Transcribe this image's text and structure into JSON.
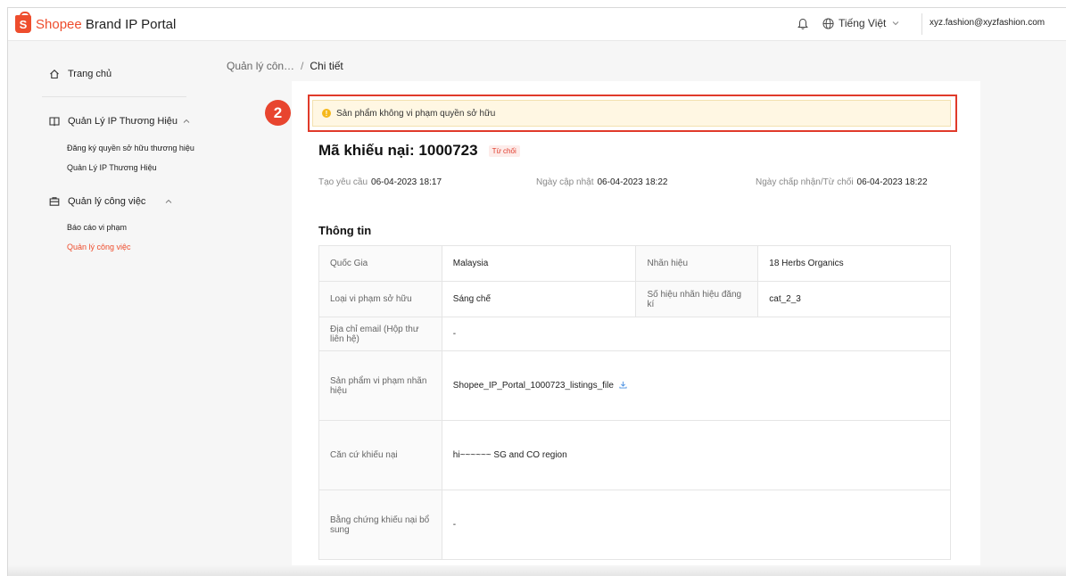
{
  "header": {
    "logo_letter": "S",
    "logo_brand": "Shopee",
    "logo_suffix": " Brand IP Portal",
    "language": "Tiếng Việt",
    "user_email": "xyz.fashion@xyzfashion.com"
  },
  "sidebar": {
    "home": "Trang chủ",
    "groups": [
      {
        "label": "Quản Lý IP Thương Hiệu",
        "items": [
          "Đăng ký quyền sở hữu thương hiệu",
          "Quản Lý IP Thương Hiệu"
        ]
      },
      {
        "label": "Quản lý công việc",
        "items": [
          "Báo cáo vi phạm",
          "Quản lý công việc"
        ]
      }
    ],
    "active_item": "Quản lý công việc"
  },
  "breadcrumb": {
    "parent": "Quản lý côn…",
    "separator": "/",
    "current": "Chi tiết"
  },
  "step_badge": "2",
  "alert": {
    "icon": "!",
    "text": "Sản phẩm không vi phạm quyền sở hữu"
  },
  "complaint": {
    "title": "Mã khiếu nại: 1000723",
    "status": "Từ chối",
    "created_label": "Tạo yêu cầu",
    "created_value": "06-04-2023 18:17",
    "updated_label": "Ngày cập nhật",
    "updated_value": "06-04-2023 18:22",
    "decided_label": "Ngày chấp nhận/Từ chối",
    "decided_value": "06-04-2023 18:22"
  },
  "info": {
    "section_title": "Thông tin",
    "rows": [
      {
        "l1": "Quốc Gia",
        "v1": "Malaysia",
        "l2": "Nhãn hiệu",
        "v2": "18 Herbs Organics"
      },
      {
        "l1": "Loại vi phạm sở hữu",
        "v1": "Sáng chế",
        "l2": "Số hiệu nhãn hiệu đăng kí",
        "v2": "cat_2_3"
      },
      {
        "l1": "Địa chỉ email (Hộp thư liên hệ)",
        "v1": "-"
      },
      {
        "l1": "Sản phẩm vi phạm nhãn hiệu",
        "v1": "Shopee_IP_Portal_1000723_listings_file"
      },
      {
        "l1": "Căn cứ khiếu nại",
        "v1": "hi~~~~~~ SG and CO region"
      },
      {
        "l1": "Bằng chứng khiếu nại bổ sung",
        "v1": "-"
      }
    ]
  },
  "colors": {
    "brand": "#ee4d2d",
    "highlight": "#e03a2a",
    "alert_bg": "#fff7e3",
    "warn": "#f5b81c"
  }
}
